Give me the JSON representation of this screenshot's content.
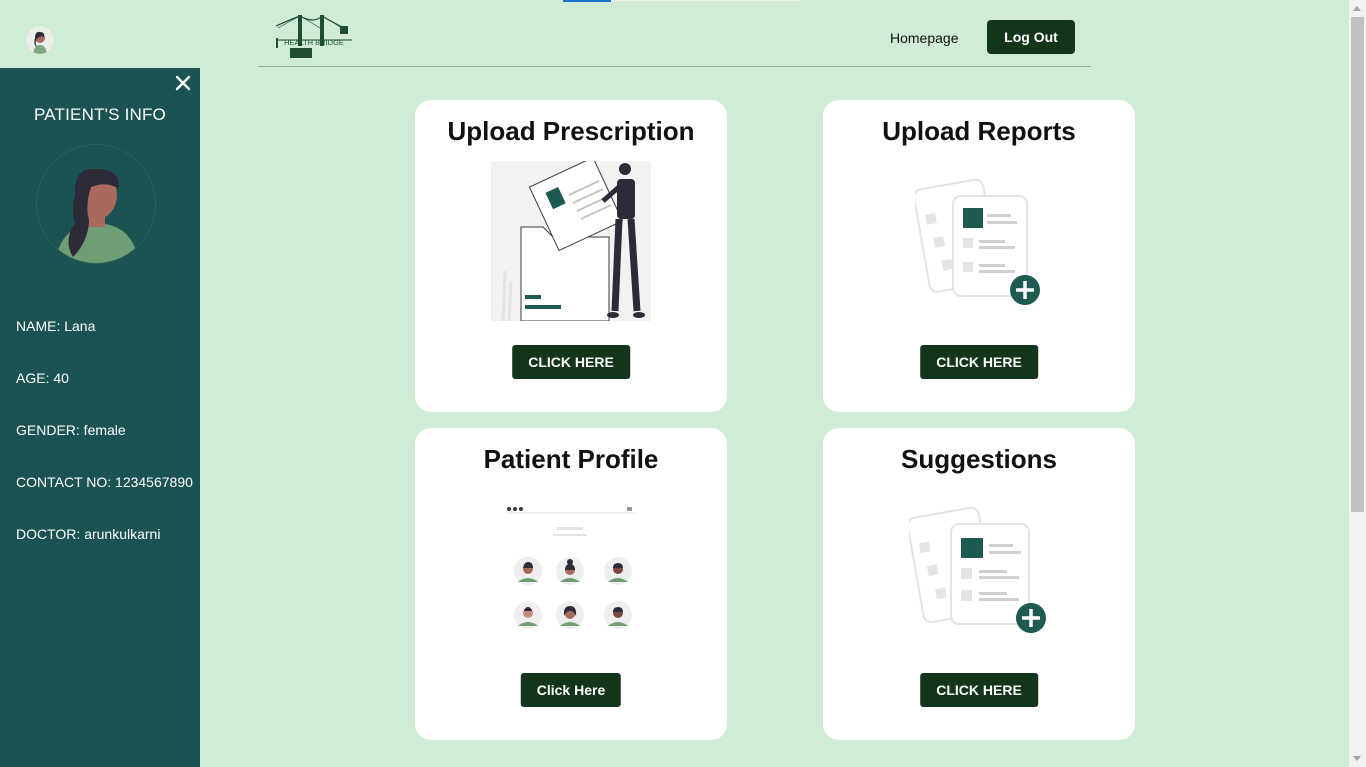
{
  "header": {
    "logo_text": "HEALTH BRIDGE",
    "nav_home": "Homepage",
    "logout": "Log Out"
  },
  "sidebar": {
    "title": "PATIENT'S INFO",
    "name": "NAME: Lana",
    "age": "AGE: 40",
    "gender": "GENDER: female",
    "contact": "CONTACT NO: 1234567890",
    "doctor": "DOCTOR: arunkulkarni"
  },
  "cards": {
    "prescription": {
      "title": "Upload Prescription",
      "button": "CLICK HERE"
    },
    "reports": {
      "title": "Upload Reports",
      "button": "CLICK HERE"
    },
    "profile": {
      "title": "Patient Profile",
      "button": "Click Here"
    },
    "suggestions": {
      "title": "Suggestions",
      "button": "CLICK HERE"
    }
  },
  "colors": {
    "background": "#d0ebd6",
    "sidebar": "#1b5353",
    "button": "#13361b",
    "accent": "#1e5a52"
  }
}
